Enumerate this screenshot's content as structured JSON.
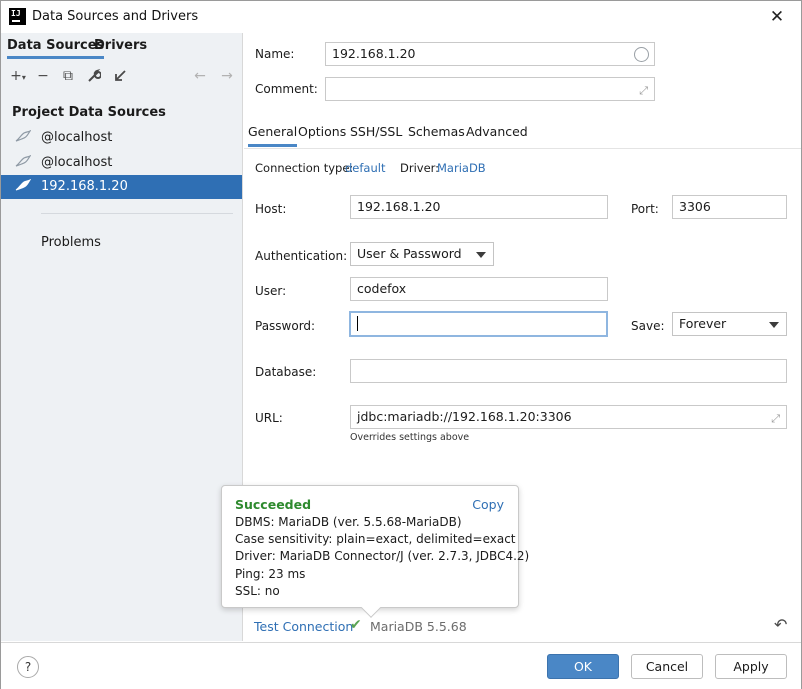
{
  "window": {
    "title": "Data Sources and Drivers",
    "app_icon_text": "IJ"
  },
  "left": {
    "tabs": [
      {
        "label": "Data Sources",
        "active": true
      },
      {
        "label": "Drivers",
        "active": false
      }
    ],
    "toolbar": [
      {
        "name": "add-icon",
        "glyph": "+"
      },
      {
        "name": "remove-icon",
        "glyph": "−"
      },
      {
        "name": "duplicate-icon",
        "glyph": "⧉"
      },
      {
        "name": "wrench-icon",
        "glyph": "🔧"
      },
      {
        "name": "import-icon",
        "glyph": "↙"
      },
      {
        "name": "back-arrow-icon",
        "glyph": "←"
      },
      {
        "name": "forward-arrow-icon",
        "glyph": "→"
      }
    ],
    "section_title": "Project Data Sources",
    "items": [
      {
        "label": "@localhost",
        "selected": false
      },
      {
        "label": "@localhost",
        "selected": false
      },
      {
        "label": "192.168.1.20",
        "selected": true
      }
    ],
    "problems_label": "Problems"
  },
  "form": {
    "name_label": "Name:",
    "name_value": "192.168.1.20",
    "comment_label": "Comment:",
    "comment_value": "",
    "tabs": [
      {
        "label": "General",
        "active": true
      },
      {
        "label": "Options",
        "active": false
      },
      {
        "label": "SSH/SSL",
        "active": false
      },
      {
        "label": "Schemas",
        "active": false
      },
      {
        "label": "Advanced",
        "active": false
      }
    ],
    "connection_type_label": "Connection type:",
    "connection_type_value": "default",
    "driver_label": "Driver:",
    "driver_value": "MariaDB",
    "host_label": "Host:",
    "host_value": "192.168.1.20",
    "port_label": "Port:",
    "port_value": "3306",
    "auth_label": "Authentication:",
    "auth_value": "User & Password",
    "user_label": "User:",
    "user_value": "codefox",
    "password_label": "Password:",
    "password_value": "",
    "save_label": "Save:",
    "save_value": "Forever",
    "database_label": "Database:",
    "database_value": "",
    "url_label": "URL:",
    "url_value": "jdbc:mariadb://192.168.1.20:3306",
    "url_note": "Overrides settings above"
  },
  "popup": {
    "title": "Succeeded",
    "copy_label": "Copy",
    "lines": [
      "DBMS: MariaDB (ver. 5.5.68-MariaDB)",
      "Case sensitivity: plain=exact, delimited=exact",
      "Driver: MariaDB Connector/J (ver. 2.7.3, JDBC4.2)",
      "Ping: 23 ms",
      "SSL: no"
    ]
  },
  "status": {
    "test_connection_label": "Test Connection",
    "server_version": "MariaDB 5.5.68"
  },
  "buttons": {
    "help": "?",
    "ok": "OK",
    "cancel": "Cancel",
    "apply": "Apply"
  },
  "colors": {
    "accent": "#4a87c6",
    "selection": "#2f6fb4",
    "success": "#2e8a2e",
    "link": "#2f6fb4"
  }
}
